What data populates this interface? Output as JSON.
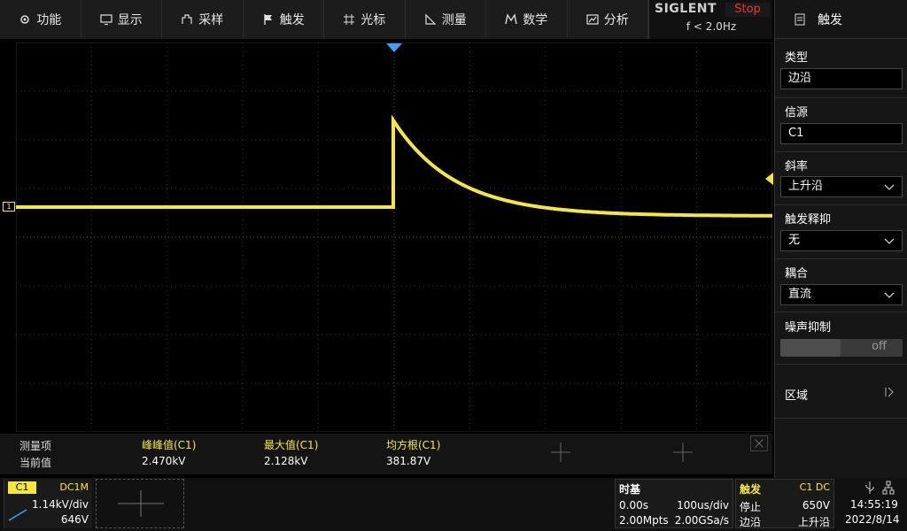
{
  "menu": [
    {
      "label": "功能",
      "icon": "gear-icon"
    },
    {
      "label": "显示",
      "icon": "monitor-icon"
    },
    {
      "label": "采样",
      "icon": "acquire-icon"
    },
    {
      "label": "触发",
      "icon": "flag-icon"
    },
    {
      "label": "光标",
      "icon": "cursor-icon"
    },
    {
      "label": "测量",
      "icon": "ruler-icon"
    },
    {
      "label": "数学",
      "icon": "math-icon"
    },
    {
      "label": "分析",
      "icon": "analysis-icon"
    }
  ],
  "brand": {
    "logo": "SIGLENT",
    "status": "Stop",
    "freq": "f < 2.0Hz"
  },
  "panel": {
    "title": "触发",
    "type_label": "类型",
    "type_value": "边沿",
    "source_label": "信源",
    "source_value": "C1",
    "slope_label": "斜率",
    "slope_value": "上升沿",
    "holdoff_label": "触发释抑",
    "holdoff_value": "无",
    "coupling_label": "耦合",
    "coupling_value": "直流",
    "noise_label": "噪声抑制",
    "noise_value": "off",
    "zone_label": "区域"
  },
  "measurement": {
    "row1_label": "测量项",
    "row2_label": "当前值",
    "items": [
      {
        "name": "峰峰值(C1)",
        "value": "2.470kV"
      },
      {
        "name": "最大值(C1)",
        "value": "2.128kV"
      },
      {
        "name": "均方根(C1)",
        "value": "381.87V"
      }
    ]
  },
  "channel1": {
    "label": "C1",
    "coupling": "DC1M",
    "scale": "1.14kV/div",
    "offset": "646V",
    "marker": "1"
  },
  "timebase": {
    "title": "时基",
    "delay": "0.00s",
    "scale": "100us/div",
    "memory": "2.00Mpts",
    "rate": "2.00GSa/s"
  },
  "trigger_status": {
    "title": "触发",
    "source": "C1 DC",
    "state": "停止",
    "level": "650V",
    "type": "边沿",
    "slope": "上升沿"
  },
  "clock": {
    "time": "14:55:19",
    "date": "2022/8/14"
  },
  "colors": {
    "ch1": "#f5e83c",
    "trigger": "#3aa0ff",
    "stop": "#ee3333"
  }
}
